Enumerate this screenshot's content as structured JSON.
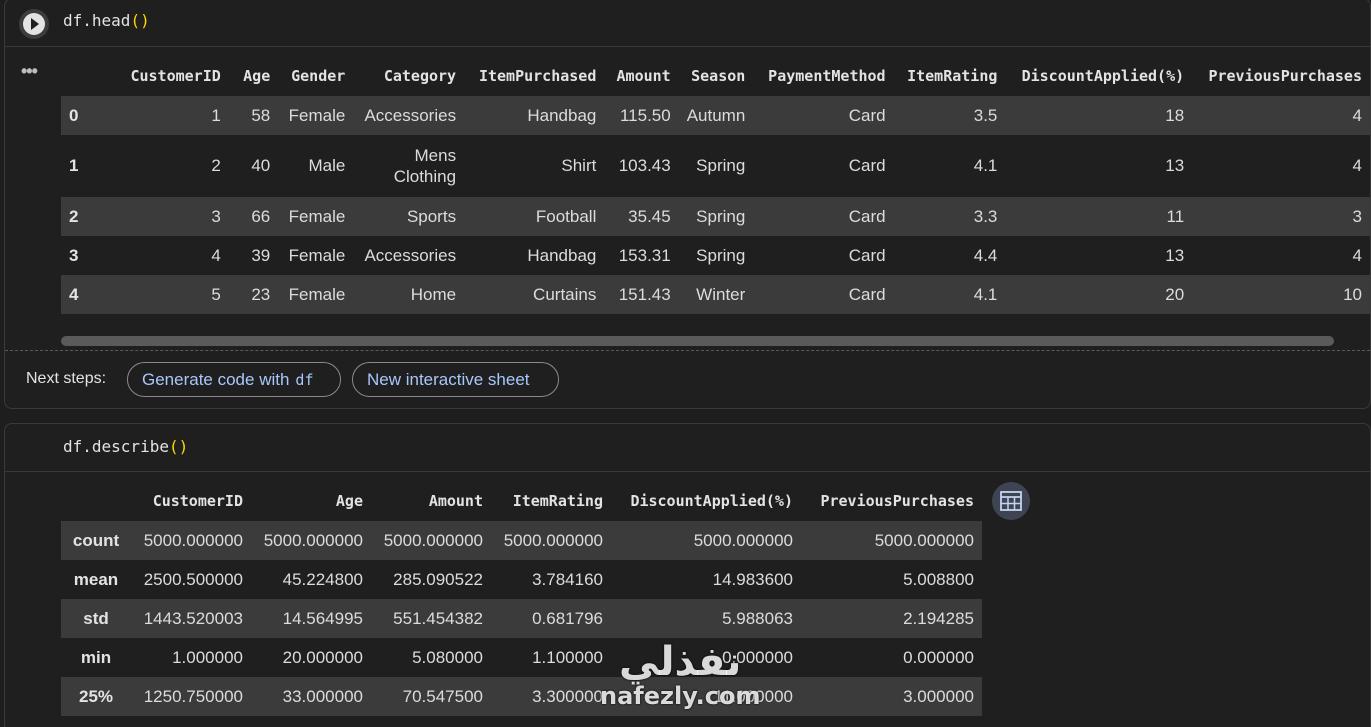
{
  "cell1": {
    "code_fn": "df.head",
    "code_paren": "()",
    "columns": [
      "",
      "CustomerID",
      "Age",
      "Gender",
      "Category",
      "ItemPurchased",
      "Amount",
      "Season",
      "PaymentMethod",
      "ItemRating",
      "DiscountApplied(%)",
      "PreviousPurchases"
    ],
    "rows": [
      [
        "0",
        "1",
        "58",
        "Female",
        "Accessories",
        "Handbag",
        "115.50",
        "Autumn",
        "Card",
        "3.5",
        "18",
        "4"
      ],
      [
        "1",
        "2",
        "40",
        "Male",
        "Mens Clothing",
        "Shirt",
        "103.43",
        "Spring",
        "Card",
        "4.1",
        "13",
        "4"
      ],
      [
        "2",
        "3",
        "66",
        "Female",
        "Sports",
        "Football",
        "35.45",
        "Spring",
        "Card",
        "3.3",
        "11",
        "3"
      ],
      [
        "3",
        "4",
        "39",
        "Female",
        "Accessories",
        "Handbag",
        "153.31",
        "Spring",
        "Card",
        "4.4",
        "13",
        "4"
      ],
      [
        "4",
        "5",
        "23",
        "Female",
        "Home",
        "Curtains",
        "151.43",
        "Winter",
        "Card",
        "4.1",
        "20",
        "10"
      ]
    ],
    "next_steps_label": "Next steps:",
    "chip_generate": "Generate code with",
    "chip_generate_var": "df",
    "chip_sheet": "New interactive sheet"
  },
  "cell2": {
    "code_fn": "df.describe",
    "code_paren": "()",
    "columns": [
      "",
      "CustomerID",
      "Age",
      "Amount",
      "ItemRating",
      "DiscountApplied(%)",
      "PreviousPurchases"
    ],
    "rows": [
      [
        "count",
        "5000.000000",
        "5000.000000",
        "5000.000000",
        "5000.000000",
        "5000.000000",
        "5000.000000"
      ],
      [
        "mean",
        "2500.500000",
        "45.224800",
        "285.090522",
        "3.784160",
        "14.983600",
        "5.008800"
      ],
      [
        "std",
        "1443.520003",
        "14.564995",
        "551.454382",
        "0.681796",
        "5.988063",
        "2.194285"
      ],
      [
        "min",
        "1.000000",
        "20.000000",
        "5.080000",
        "1.100000",
        "0.000000",
        "0.000000"
      ],
      [
        "25%",
        "1250.750000",
        "33.000000",
        "70.547500",
        "3.300000",
        "11.000000",
        "3.000000"
      ]
    ]
  },
  "watermark": {
    "arabic": "نفذلي",
    "latin": "nafezly.com"
  },
  "icons": {
    "run": "play-icon",
    "more": "more-horiz-icon",
    "table": "table-view-icon"
  }
}
